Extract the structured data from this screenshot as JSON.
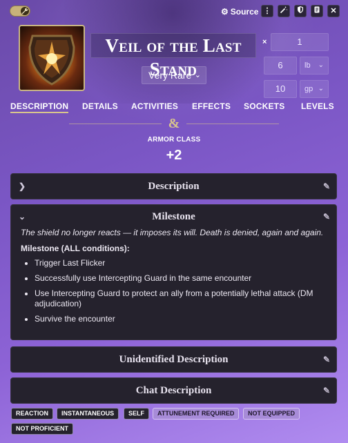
{
  "header": {
    "source_label": "Source",
    "item_name": "Veil of the Last Stand",
    "quantity_prefix": "×",
    "quantity": "1",
    "weight": "6",
    "weight_unit": "lb",
    "price": "10",
    "price_unit": "gp",
    "rarity": "Very Rare"
  },
  "icons": {
    "toggle": "wrench-icon",
    "source": "gear-icon",
    "menu": "vertical-ellipsis-icon",
    "identify": "magic-wand-icon",
    "shield": "shield-icon",
    "document": "scroll-icon",
    "close": "close-icon"
  },
  "tabs": [
    "DESCRIPTION",
    "DETAILS",
    "ACTIVITIES",
    "EFFECTS",
    "SOCKETS",
    "LEVELS"
  ],
  "armor": {
    "label": "ARMOR CLASS",
    "value": "+2"
  },
  "sections": {
    "description": {
      "title": "Description"
    },
    "milestone": {
      "title": "Milestone",
      "flavor": "The shield no longer reacts — it imposes its will. Death is denied, again and again.",
      "conditions_label": "Milestone (ALL conditions):",
      "conditions": [
        "Trigger Last Flicker",
        "Successfully use Intercepting Guard in the same encounter",
        "Use Intercepting Guard to protect an ally from a potentially lethal attack (DM adjudication)",
        "Survive the encounter"
      ]
    },
    "unidentified": {
      "title": "Unidentified Description"
    },
    "chat": {
      "title": "Chat Description"
    }
  },
  "tags": [
    "REACTION",
    "INSTANTANEOUS",
    "SELF",
    "ATTUNEMENT REQUIRED",
    "NOT EQUIPPED",
    "NOT PROFICIENT"
  ],
  "colors": {
    "background_start": "#6a4aa8",
    "background_end": "#b08cf0",
    "panel": "#25222d",
    "accent_gold": "#d9c58c",
    "tag_highlight": "#a78bd8"
  }
}
